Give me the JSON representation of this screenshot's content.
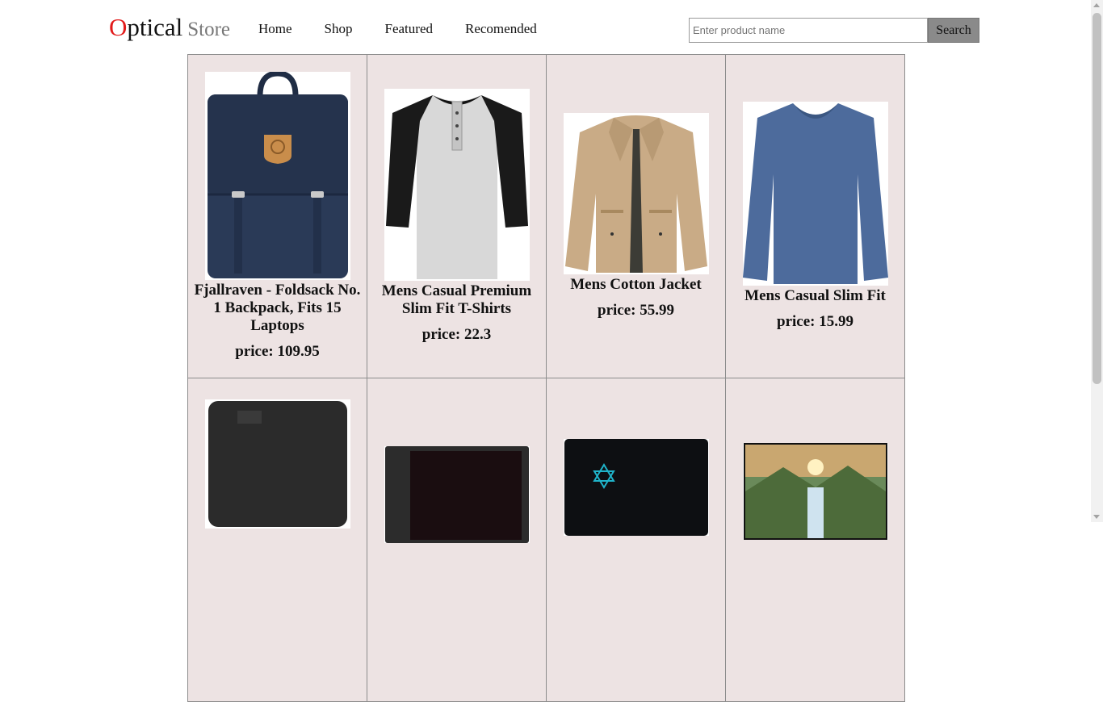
{
  "header": {
    "logo": {
      "first_letter": "O",
      "rest": "ptical",
      "store": "Store"
    },
    "nav": [
      "Home",
      "Shop",
      "Featured",
      "Recomended"
    ],
    "search": {
      "placeholder": "Enter product name",
      "value": "",
      "button_label": "Search"
    }
  },
  "products": [
    {
      "title": "Fjallraven - Foldsack No. 1 Backpack, Fits 15 Laptops",
      "price_label": "price: 109.95",
      "image": "navy-backpack"
    },
    {
      "title": "Mens Casual Premium Slim Fit T-Shirts",
      "price_label": "price: 22.3",
      "image": "raglan-tshirt"
    },
    {
      "title": "Mens Cotton Jacket",
      "price_label": "price: 55.99",
      "image": "khaki-jacket"
    },
    {
      "title": "Mens Casual Slim Fit",
      "price_label": "price: 15.99",
      "image": "blue-longsleeve"
    },
    {
      "image": "wd-elements-drive"
    },
    {
      "image": "sandisk-ssd-plus"
    },
    {
      "image": "silicon-power-ssd"
    },
    {
      "image": "landscape-monitor"
    }
  ],
  "colors": {
    "logo_accent": "#e21b1b",
    "card_background": "#ede3e3",
    "search_button": "#8a8a8a"
  }
}
